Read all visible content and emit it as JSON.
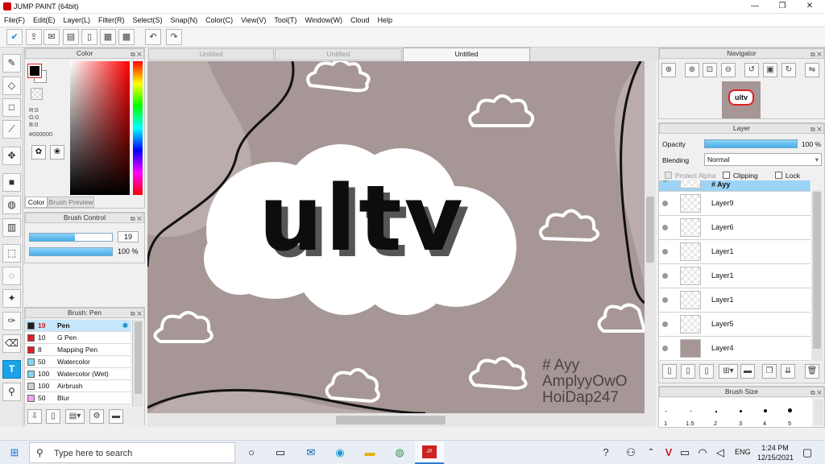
{
  "window": {
    "title": "JUMP PAINT (64bit)",
    "min": "—",
    "max": "❐",
    "close": "✕"
  },
  "menu": [
    "File(F)",
    "Edit(E)",
    "Layer(L)",
    "Filter(R)",
    "Select(S)",
    "Snap(N)",
    "Color(C)",
    "View(V)",
    "Tool(T)",
    "Window(W)",
    "Cloud",
    "Help"
  ],
  "color_panel": {
    "title": "Color",
    "r": "R:0",
    "g": "G:0",
    "b": "B:0",
    "hex": "#000000",
    "tab_color": "Color",
    "tab_preview": "Brush Preview"
  },
  "brush_control": {
    "title": "Brush Control",
    "size": "19",
    "size_fraction": 0.55,
    "opacity": "100 %",
    "opacity_fraction": 1.0
  },
  "brush_list": {
    "title": "Brush: Pen",
    "items": [
      {
        "size": "19",
        "name": "Pen",
        "color": "#202020"
      },
      {
        "size": "10",
        "name": "G Pen",
        "color": "#e02020"
      },
      {
        "size": "8",
        "name": "Mapping Pen",
        "color": "#e02020"
      },
      {
        "size": "50",
        "name": "Watercolor",
        "color": "#7fd8f0"
      },
      {
        "size": "100",
        "name": "Watercolor (Wet)",
        "color": "#7fd8f0"
      },
      {
        "size": "100",
        "name": "Airbrush",
        "color": "#d0d0d0"
      },
      {
        "size": "50",
        "name": "Blur",
        "color": "#f4a0f0"
      }
    ]
  },
  "canvas_tabs": [
    "Untitled",
    "Untitled",
    "Untitled"
  ],
  "canvas_art": {
    "logo_text": "ultv",
    "watermark": [
      "# Ayy",
      "AmplyyOwO",
      "HoiDap247"
    ]
  },
  "navigator": {
    "title": "Navigator",
    "thumb_text": "ultv"
  },
  "layer_panel": {
    "title": "Layer",
    "opacity_label": "Opacity",
    "opacity_value": "100 %",
    "opacity_fraction": 1.0,
    "blending_label": "Blending",
    "blending_value": "Normal",
    "protect_alpha": "Protect Alpha",
    "clipping": "Clipping",
    "lock": "Lock",
    "layers": [
      "# Ayy",
      "Layer9",
      "Layer6",
      "Layer1",
      "Layer1",
      "Layer1",
      "Layer5",
      "Layer4"
    ]
  },
  "brush_size": {
    "title": "Brush Size",
    "ticks": [
      "1",
      "1.5",
      "2",
      "3",
      "4",
      "5"
    ]
  },
  "taskbar": {
    "search_placeholder": "Type here to search",
    "lang": "ENG",
    "time": "1:24 PM",
    "date": "12/15/2021"
  },
  "colors": {
    "accent": "#1aa3e8",
    "canvas_bg": "#a69696",
    "canvas_wave": "#b9acaa"
  }
}
